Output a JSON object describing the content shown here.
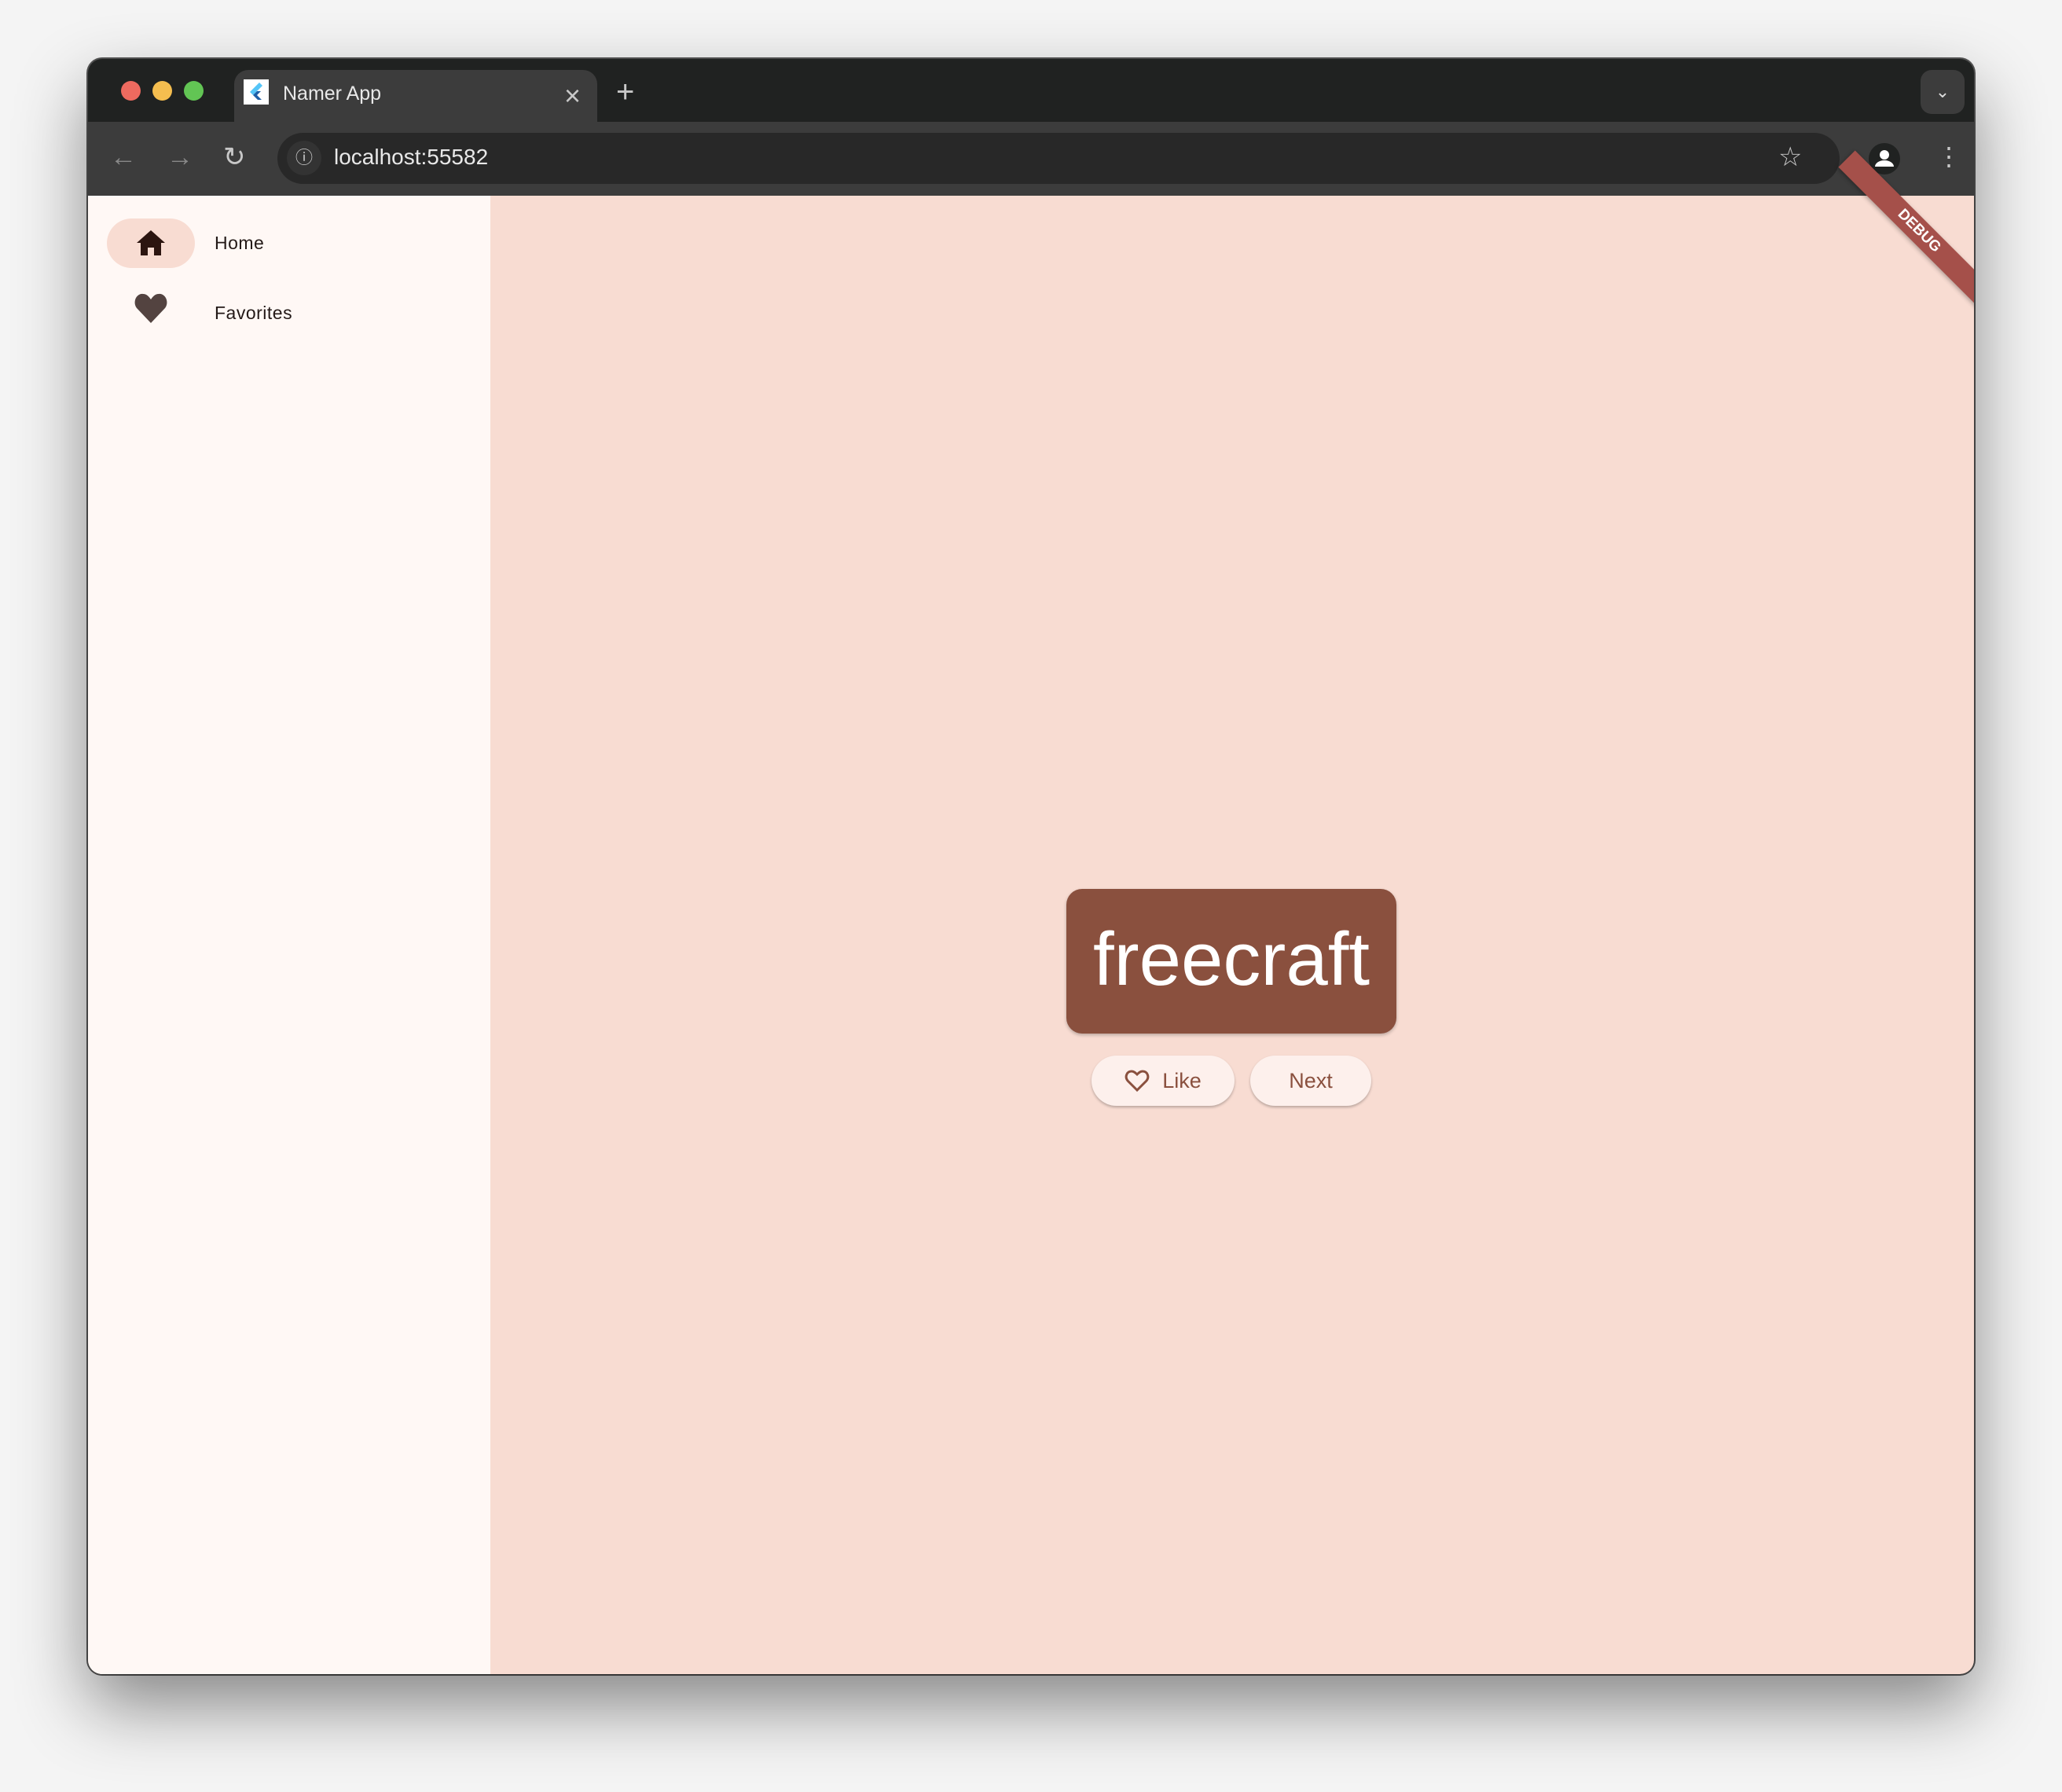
{
  "browser": {
    "tab_title": "Namer App",
    "url": "localhost:55582",
    "new_tab": "+",
    "close": "×"
  },
  "sidebar": {
    "items": [
      {
        "label": "Home",
        "icon": "home-icon",
        "selected": true
      },
      {
        "label": "Favorites",
        "icon": "heart-icon",
        "selected": false
      }
    ]
  },
  "main": {
    "word": "freecraft",
    "like_label": "Like",
    "next_label": "Next"
  },
  "debug_banner": "DEBUG",
  "colors": {
    "primary": "#8a503e",
    "background": "#f8dcd2",
    "sidebar": "#fff8f5"
  }
}
